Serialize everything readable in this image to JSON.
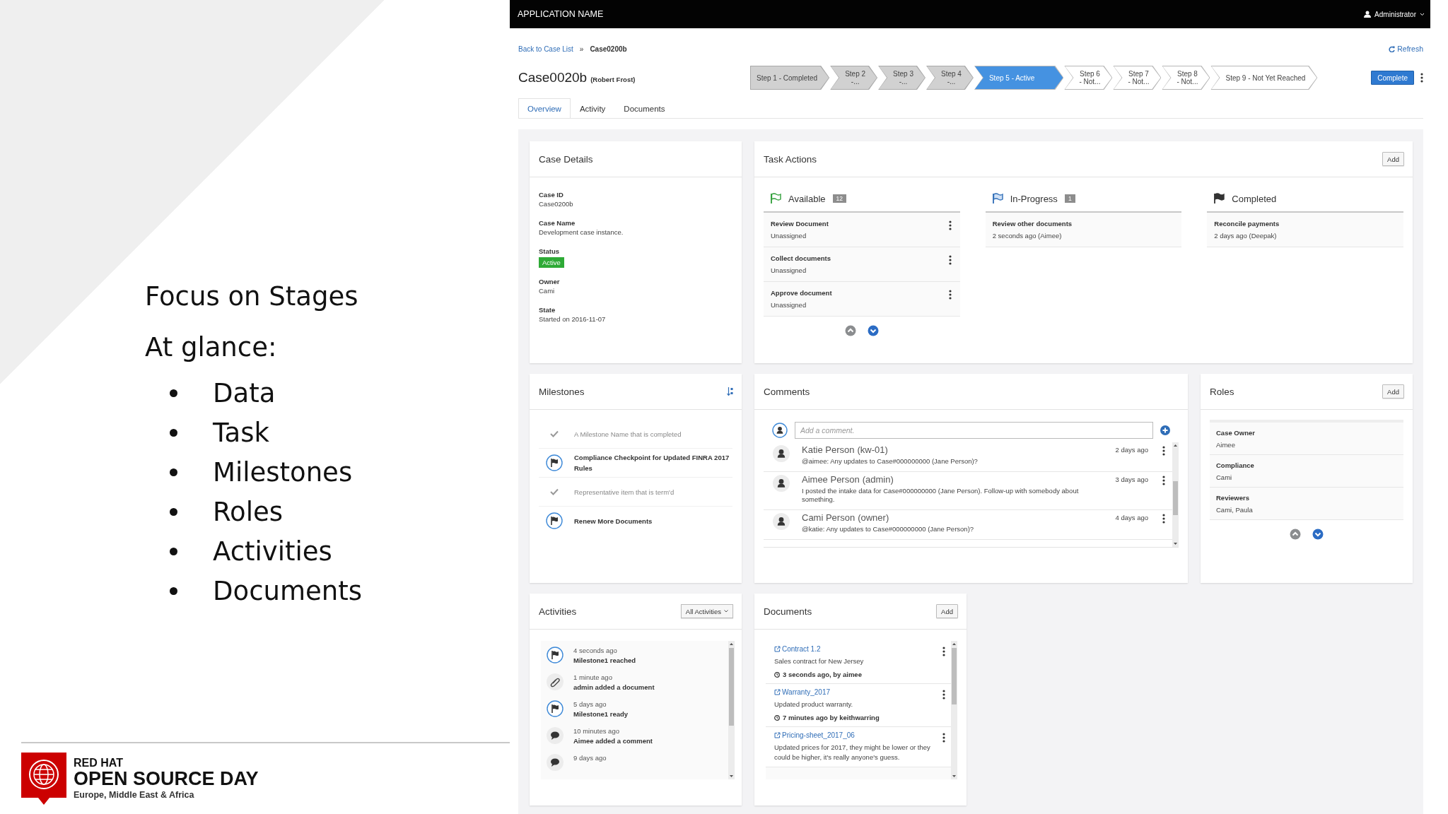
{
  "slide": {
    "heading": "Focus on Stages",
    "subheading": "At glance:",
    "bullets": [
      "Data",
      "Task",
      "Milestones",
      "Roles",
      "Activities",
      "Documents"
    ],
    "footer": {
      "brand": "RED HAT",
      "event": "OPEN SOURCE DAY",
      "region": "Europe, Middle East & Africa"
    }
  },
  "app": {
    "title": "APPLICATION NAME",
    "user": "Administrator"
  },
  "breadcrumb": {
    "link": "Back to Case List",
    "separator": "»",
    "current": "Case0200b"
  },
  "refresh": "Refresh",
  "case": {
    "title": "Case0020b",
    "owner": "(Robert Frost)"
  },
  "stages": [
    {
      "label": "Step 1 - Completed",
      "completed": true,
      "active": false
    },
    {
      "label": "Step 2\n-...",
      "completed": true,
      "active": false
    },
    {
      "label": "Step 3\n-...",
      "completed": true,
      "active": false
    },
    {
      "label": "Step 4\n-...",
      "completed": true,
      "active": false
    },
    {
      "label": "Step 5 - Active",
      "completed": false,
      "active": true
    },
    {
      "label": "Step 6\n- Not...",
      "completed": false,
      "active": false
    },
    {
      "label": "Step 7\n- Not...",
      "completed": false,
      "active": false
    },
    {
      "label": "Step 8\n- Not...",
      "completed": false,
      "active": false
    },
    {
      "label": "Step 9 - Not Yet Reached",
      "completed": false,
      "active": false
    }
  ],
  "complete_button": "Complete",
  "tabs": [
    {
      "label": "Overview",
      "selected": true
    },
    {
      "label": "Activity",
      "selected": false
    },
    {
      "label": "Documents",
      "selected": false
    }
  ],
  "case_details": {
    "title": "Case Details",
    "fields": [
      {
        "label": "Case ID",
        "value": "Case0200b",
        "kind": "text"
      },
      {
        "label": "Case Name",
        "value": "Development case instance.",
        "kind": "text"
      },
      {
        "label": "Status",
        "value": "Active",
        "kind": "badge"
      },
      {
        "label": "Owner",
        "value": "Cami",
        "kind": "text"
      },
      {
        "label": "State",
        "value": "Started on 2016-11-07",
        "kind": "text"
      }
    ]
  },
  "task_actions": {
    "title": "Task Actions",
    "add_button": "Add",
    "lanes": [
      {
        "title": "Available",
        "count": "12",
        "kind": "available",
        "items": [
          {
            "title": "Review Document",
            "subtitle": "Unassigned",
            "menu": true
          },
          {
            "title": "Collect documents",
            "subtitle": "Unassigned",
            "menu": true
          },
          {
            "title": "Approve document",
            "subtitle": "Unassigned",
            "menu": true
          }
        ],
        "pager": {
          "previous_disabled": true,
          "next_disabled": false
        }
      },
      {
        "title": "In-Progress",
        "count": "1",
        "kind": "in_progress",
        "items": [
          {
            "title": "Review other documents",
            "subtitle": "2 seconds ago (Aimee)",
            "menu": false
          }
        ]
      },
      {
        "title": "Completed",
        "kind": "completed",
        "items": [
          {
            "title": "Reconcile payments",
            "subtitle": "2 days ago (Deepak)",
            "menu": false
          }
        ]
      }
    ]
  },
  "milestones": {
    "title": "Milestones",
    "items": [
      {
        "text": "A Milestone Name that is completed",
        "completed": true
      },
      {
        "text": "Compliance Checkpoint for Updated FINRA 2017 Rules",
        "completed": false
      },
      {
        "text": "Representative item that is term'd",
        "completed": true
      },
      {
        "text": "Renew More Documents",
        "completed": false
      }
    ]
  },
  "comments": {
    "title": "Comments",
    "placeholder": "Add a comment.",
    "items": [
      {
        "author": "Katie Person",
        "role": "(kw-01)",
        "time": "2 days ago",
        "text": "@aimee: Any updates to Case#000000000 (Jane Person)?"
      },
      {
        "author": "Aimee Person",
        "role": "(admin)",
        "time": "3 days ago",
        "text": "I posted the intake data for Case#000000000 (Jane Person). Follow-up with somebody about something."
      },
      {
        "author": "Cami Person",
        "role": "(owner)",
        "time": "4 days ago",
        "text": "@katie: Any updates to Case#000000000 (Jane Person)?"
      }
    ]
  },
  "roles": {
    "title": "Roles",
    "add_button": "Add",
    "items": [
      {
        "role": "Case Owner",
        "members": "Aimee"
      },
      {
        "role": "Compliance",
        "members": "Cami"
      },
      {
        "role": "Reviewers",
        "members": "Cami, Paula"
      }
    ],
    "pager": {
      "previous_disabled": true,
      "next_disabled": false
    }
  },
  "activities": {
    "title": "Activities",
    "filter": "All Activities",
    "items": [
      {
        "time": "4 seconds ago",
        "text": "Milestone1 reached",
        "kind": "milestone"
      },
      {
        "time": "1 minute ago",
        "text": "admin added a document",
        "kind": "document"
      },
      {
        "time": "5 days ago",
        "text": "Milestone1 ready",
        "kind": "milestone"
      },
      {
        "time": "10 minutes ago",
        "text": "Aimee added a comment",
        "kind": "comment"
      },
      {
        "time": "9 days ago",
        "kind": "comment"
      }
    ]
  },
  "documents": {
    "title": "Documents",
    "add_button": "Add",
    "items": [
      {
        "name": "Contract 1.2",
        "description": "Sales contract for New Jersey",
        "meta": "3 seconds ago, by aimee"
      },
      {
        "name": "Warranty_2017",
        "description": "Updated product warranty.",
        "meta": "7 minutes ago by keithwarring"
      },
      {
        "name": "Pricing-sheet_2017_06",
        "description": "Updated prices for 2017, they might be lower or they could be higher, it's really anyone's guess."
      }
    ]
  }
}
